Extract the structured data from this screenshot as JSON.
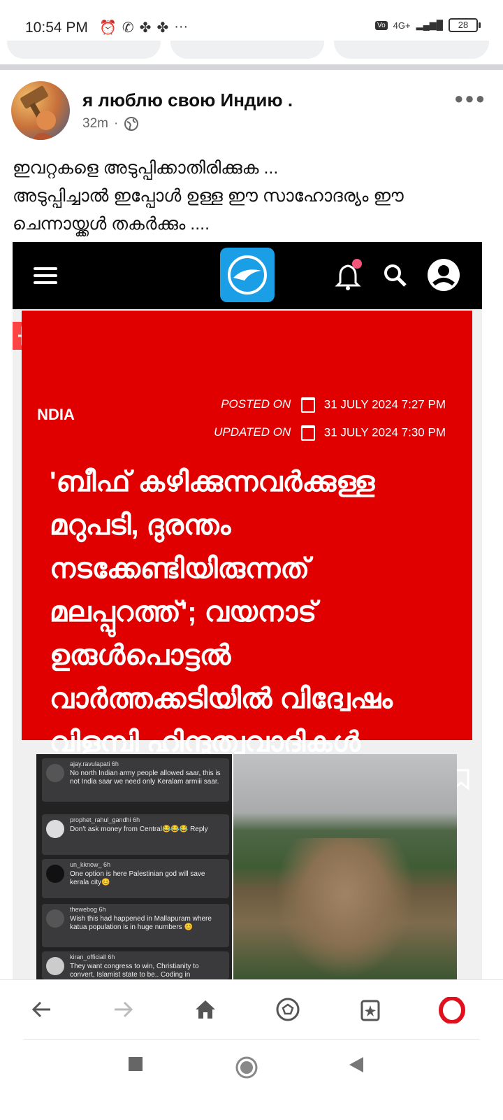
{
  "status": {
    "time": "10:54 PM",
    "net": "4G+",
    "battery": "28"
  },
  "post": {
    "author": "я люблю свою Индию .",
    "time": "32m",
    "text_lines": [
      "ഇവറ്റകളെ അടുപ്പിക്കാതിരിക്കുക ...",
      "അടുപ്പിച്ചാൽ ഇപ്പോൾ ഉള്ള ഈ സാഹോദര്യം ഈ",
      "ചെന്നായ്ക്കൾ തകർക്കും ...."
    ]
  },
  "article": {
    "category": "NDIA",
    "posted_label": "POSTED ON",
    "posted_date": "31 JULY 2024 7:27 PM",
    "updated_label": "UPDATED ON",
    "updated_date": "31 JULY 2024 7:30 PM",
    "headline_lines": [
      "'ബീഫ് കഴിക്കുന്നവർക്കുള്ള",
      "മറുപടി, ദുരന്തം",
      "നടക്കേണ്ടിയിരുന്നത്",
      "മലപ്പുറത്ത്'; വയനാട്",
      "ഉരുൾപൊട്ടൽ",
      "വാർത്തക്കടിയിൽ വിദ്വേഷം",
      "വിളമ്പി ഹിന്ദുത്വവാദികൾ"
    ],
    "tt": "TT"
  },
  "comments": [
    {
      "user": "ajay.ravulapati  6h",
      "text": "No north Indian army people allowed saar, this is not India saar we need only Keralam armiii saar."
    },
    {
      "user": "prophet_rahul_gandhi  6h",
      "text": "Don't ask money from Central😂😂😂  Reply"
    },
    {
      "user": "un_kknow_  6h",
      "text": "One option is here Palestinian god will save kerala city😊"
    },
    {
      "user": "thewebog  6h",
      "text": "Wish this had happened in Mallapuram where katua population is in huge numbers 😊"
    },
    {
      "user": "kiran_officiall  6h",
      "text": "They want congress to win, Christianity to convert, Islamist state to be.. Coding in"
    }
  ]
}
